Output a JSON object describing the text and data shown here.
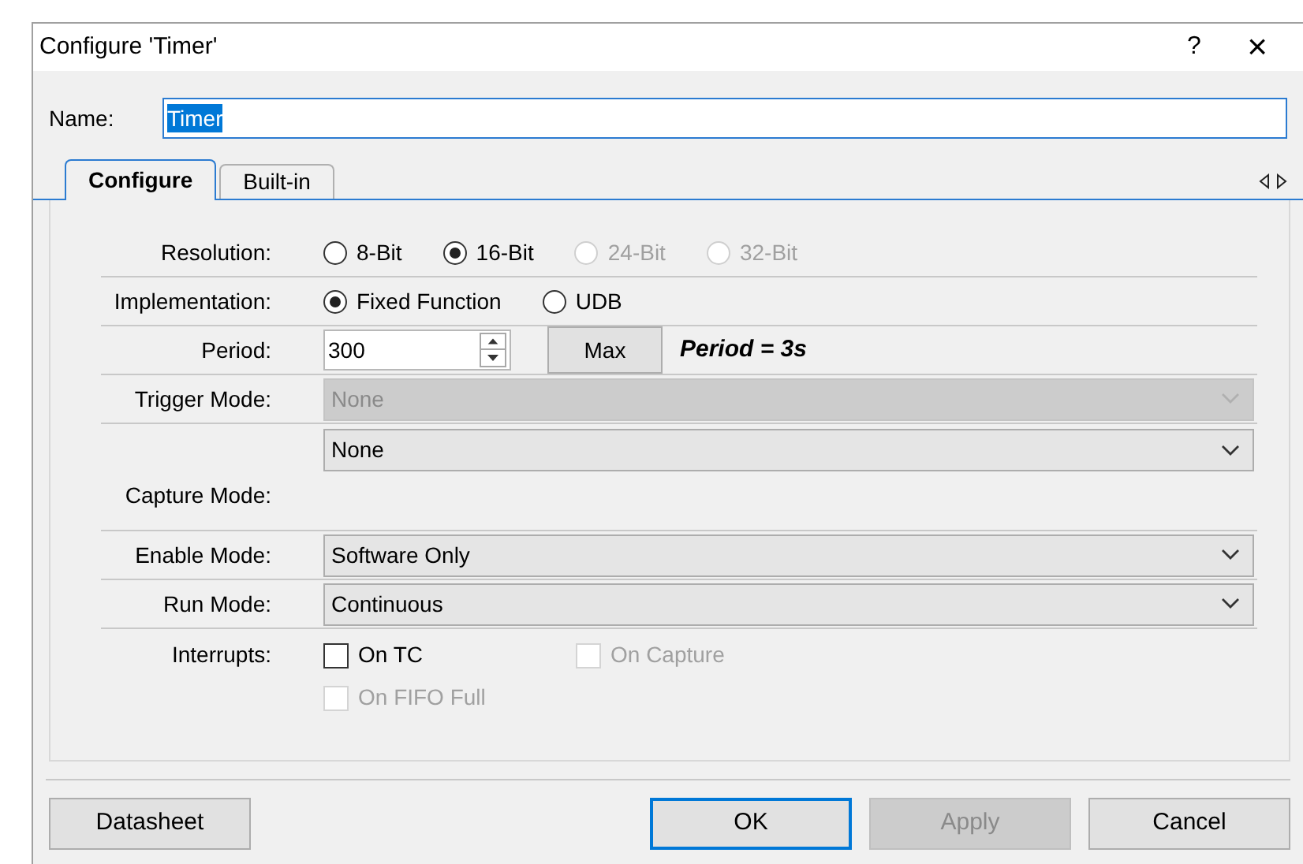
{
  "window": {
    "title": "Configure 'Timer'",
    "help": "?",
    "close": "×"
  },
  "name_field": {
    "label": "Name:",
    "value": "Timer"
  },
  "tabs": [
    {
      "label": "Configure",
      "selected": true
    },
    {
      "label": "Built-in",
      "selected": false
    }
  ],
  "rows": [
    {
      "kind": "radio",
      "label": "Resolution:",
      "options": [
        {
          "label": "8-Bit",
          "selected": false,
          "disabled": false
        },
        {
          "label": "16-Bit",
          "selected": true,
          "disabled": false
        },
        {
          "label": "24-Bit",
          "selected": false,
          "disabled": true
        },
        {
          "label": "32-Bit",
          "selected": false,
          "disabled": true
        }
      ]
    },
    {
      "kind": "radio",
      "label": "Implementation:",
      "options": [
        {
          "label": "Fixed Function",
          "selected": true,
          "disabled": false
        },
        {
          "label": "UDB",
          "selected": false,
          "disabled": false
        }
      ]
    },
    {
      "kind": "spin",
      "label": "Period:",
      "value": "300",
      "button": "Max",
      "note": "Period = 3s"
    },
    {
      "kind": "select",
      "label": "Trigger Mode:",
      "value": "None",
      "disabled": true
    },
    {
      "kind": "select",
      "label": "Capture Mode:",
      "value": "None",
      "disabled": false,
      "tall": true
    },
    {
      "kind": "select",
      "label": "Enable Mode:",
      "value": "Software Only",
      "disabled": false
    },
    {
      "kind": "select",
      "label": "Run Mode:",
      "value": "Continuous",
      "disabled": false
    },
    {
      "kind": "checks",
      "label": "Interrupts:",
      "options": [
        {
          "label": "On TC",
          "checked": false,
          "disabled": false
        },
        {
          "label": "On Capture",
          "checked": false,
          "disabled": true
        },
        {
          "label": "On FIFO Full",
          "checked": false,
          "disabled": true
        }
      ]
    }
  ],
  "buttons": [
    {
      "label": "Datasheet",
      "default": false,
      "disabled": false
    },
    {
      "label": "OK",
      "default": true,
      "disabled": false
    },
    {
      "label": "Apply",
      "default": false,
      "disabled": true
    },
    {
      "label": "Cancel",
      "default": false,
      "disabled": false
    }
  ]
}
